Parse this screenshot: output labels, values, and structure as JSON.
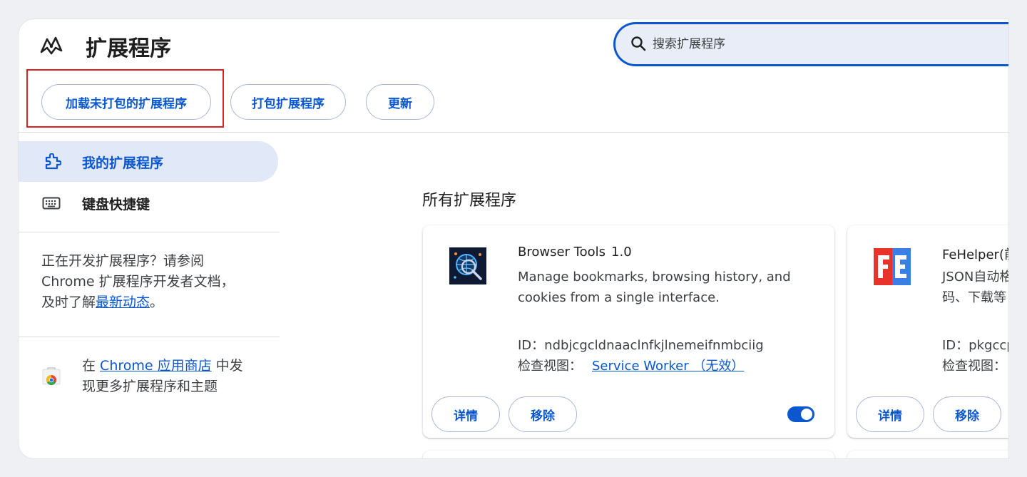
{
  "header": {
    "title": "扩展程序",
    "search_placeholder": "搜索扩展程序"
  },
  "toolbar": {
    "load_unpacked": "加载未打包的扩展程序",
    "pack_extension": "打包扩展程序",
    "update": "更新"
  },
  "sidebar": {
    "items": [
      {
        "label": "我的扩展程序",
        "icon": "puzzle-icon",
        "active": true
      },
      {
        "label": "键盘快捷键",
        "icon": "keyboard-icon",
        "active": false
      }
    ],
    "dev_text_line1": "正在开发扩展程序？请参阅",
    "dev_text_line2": "Chrome 扩展程序开发者文档，",
    "dev_text_line3_prefix": "及时了解",
    "dev_text_link": "最新动态",
    "dev_text_line3_suffix": "。",
    "store_prefix": "在 ",
    "store_link": "Chrome 应用商店",
    "store_suffix": " 中发",
    "store_line2": "现更多扩展程序和主题"
  },
  "main": {
    "section_title": "所有扩展程序",
    "extensions": [
      {
        "name": "Browser Tools",
        "version": "1.0",
        "description_line1": "Manage bookmarks, browsing history, and",
        "description_line2": "cookies from a single interface.",
        "id_label": "ID：",
        "id": "ndbjcgcldnaaclnfkjlnemeifnmbciig",
        "inspect_label": "检查视图：",
        "inspect_link": "Service Worker （无效）",
        "details_label": "详情",
        "remove_label": "移除",
        "enabled": true
      },
      {
        "name": "FeHelper(前",
        "description_line1": "JSON自动格",
        "description_line2": "码、下载等",
        "id_label": "ID：",
        "id": "pkgccp",
        "inspect_label": "检查视图：",
        "details_label": "详情",
        "remove_label": "移除"
      }
    ]
  },
  "colors": {
    "accent": "#0b57d0",
    "active_nav_bg": "#e1e9f8",
    "highlight_box": "#e02020"
  }
}
